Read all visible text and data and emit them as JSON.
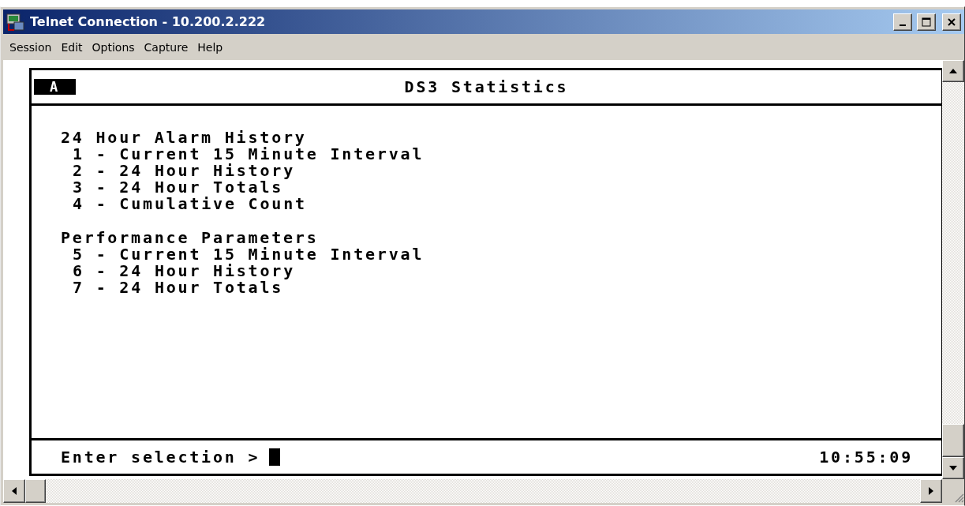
{
  "window": {
    "title": "Telnet Connection - 10.200.2.222"
  },
  "menu": [
    "Session",
    "Edit",
    "Options",
    "Capture",
    "Help"
  ],
  "terminal": {
    "badge": "A",
    "title": "DS3 Statistics",
    "sections": [
      {
        "heading": "24 Hour Alarm History",
        "items": [
          "1 - Current 15 Minute Interval",
          "2 - 24 Hour History",
          "3 - 24 Hour Totals",
          "4 - Cumulative Count"
        ]
      },
      {
        "heading": "Performance Parameters",
        "items": [
          "5 - Current 15 Minute Interval",
          "6 - 24 Hour History",
          "7 - 24 Hour Totals"
        ]
      }
    ],
    "prompt": "Enter selection >",
    "time": "10:55:09"
  }
}
